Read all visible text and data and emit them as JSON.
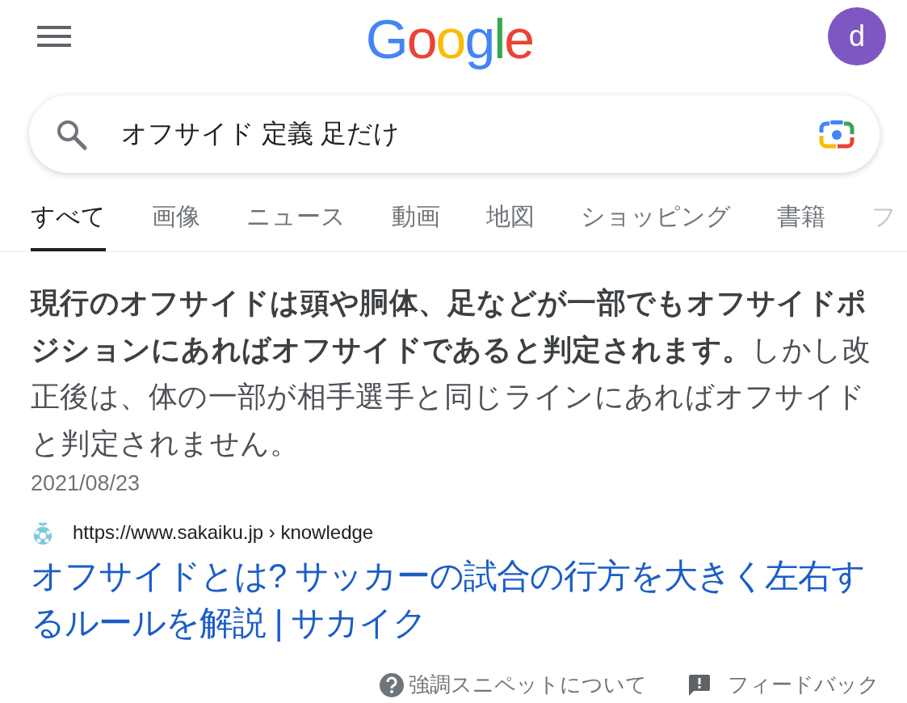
{
  "header": {
    "logo": "Google",
    "avatar": "d"
  },
  "search": {
    "value": "オフサイド 定義 足だけ"
  },
  "tabs": [
    {
      "label": "すべて",
      "selected": true
    },
    {
      "label": "画像",
      "selected": false
    },
    {
      "label": "ニュース",
      "selected": false
    },
    {
      "label": "動画",
      "selected": false
    },
    {
      "label": "地図",
      "selected": false
    },
    {
      "label": "ショッピング",
      "selected": false
    },
    {
      "label": "書籍",
      "selected": false
    },
    {
      "label": "フ",
      "selected": false
    }
  ],
  "snippet": {
    "text": "**現行のオフサイドは頭や胴体、足などが一部でもオフサイドポジションにあればオフサイドであると判定されます。**しかし改正後は、体の一部が相手選手と同じラインにあればオフサイドと判定されません。",
    "date": "2021/08/23",
    "url": "https://www.sakaiku.jp › knowledge",
    "title": "オフサイドとは? サッカーの試合の行方を大きく左右するルールを解説 | サカイク"
  },
  "footer": {
    "about": "強調スニペットについて",
    "feedback": "フィードバック"
  }
}
